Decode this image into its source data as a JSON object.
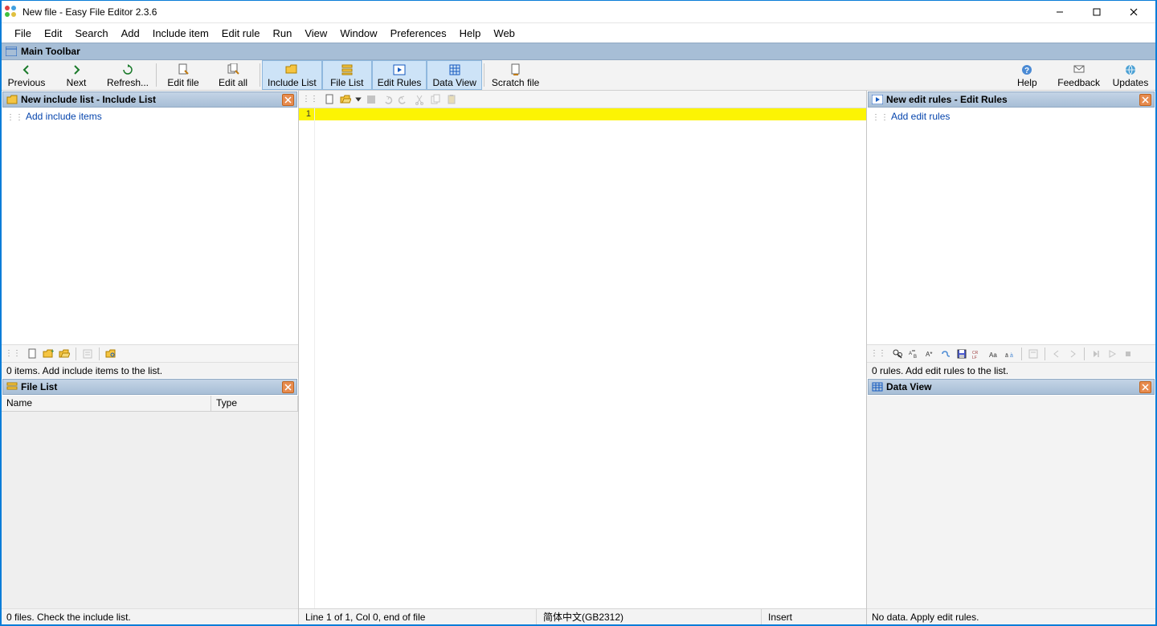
{
  "window": {
    "title": "New file - Easy File Editor 2.3.6"
  },
  "menu": [
    "File",
    "Edit",
    "Search",
    "Add",
    "Include item",
    "Edit rule",
    "Run",
    "View",
    "Window",
    "Preferences",
    "Help",
    "Web"
  ],
  "main_toolbar": {
    "label": "Main Toolbar",
    "items_left": [
      {
        "id": "previous",
        "label": "Previous"
      },
      {
        "id": "next",
        "label": "Next"
      },
      {
        "id": "refresh",
        "label": "Refresh..."
      },
      {
        "id": "sep",
        "label": ""
      },
      {
        "id": "edit-file",
        "label": "Edit file"
      },
      {
        "id": "edit-all",
        "label": "Edit all"
      },
      {
        "id": "sep",
        "label": ""
      },
      {
        "id": "include-list",
        "label": "Include List",
        "active": true
      },
      {
        "id": "file-list",
        "label": "File List",
        "active": true
      },
      {
        "id": "edit-rules",
        "label": "Edit Rules",
        "active": true
      },
      {
        "id": "data-view",
        "label": "Data View",
        "active": true
      },
      {
        "id": "sep",
        "label": ""
      },
      {
        "id": "scratch-file",
        "label": "Scratch file"
      }
    ],
    "items_right": [
      {
        "id": "help",
        "label": "Help"
      },
      {
        "id": "feedback",
        "label": "Feedback"
      },
      {
        "id": "updates",
        "label": "Updates"
      }
    ]
  },
  "panels": {
    "include_list": {
      "title": "New include list - Include List",
      "link": "Add include items",
      "hint": "0 items. Add include items to the list."
    },
    "file_list": {
      "title": "File List",
      "columns": {
        "name": "Name",
        "type": "Type"
      },
      "hint": "0 files. Check the include list."
    },
    "edit_rules": {
      "title": "New edit rules - Edit Rules",
      "link": "Add edit rules",
      "hint": "0 rules. Add edit rules to the list."
    },
    "data_view": {
      "title": "Data View",
      "hint": "No data. Apply edit rules."
    }
  },
  "editor": {
    "line_number": "1"
  },
  "status": {
    "cursor": "Line 1 of 1, Col 0, end of file",
    "encoding": "简体中文(GB2312)",
    "insert": "Insert"
  }
}
